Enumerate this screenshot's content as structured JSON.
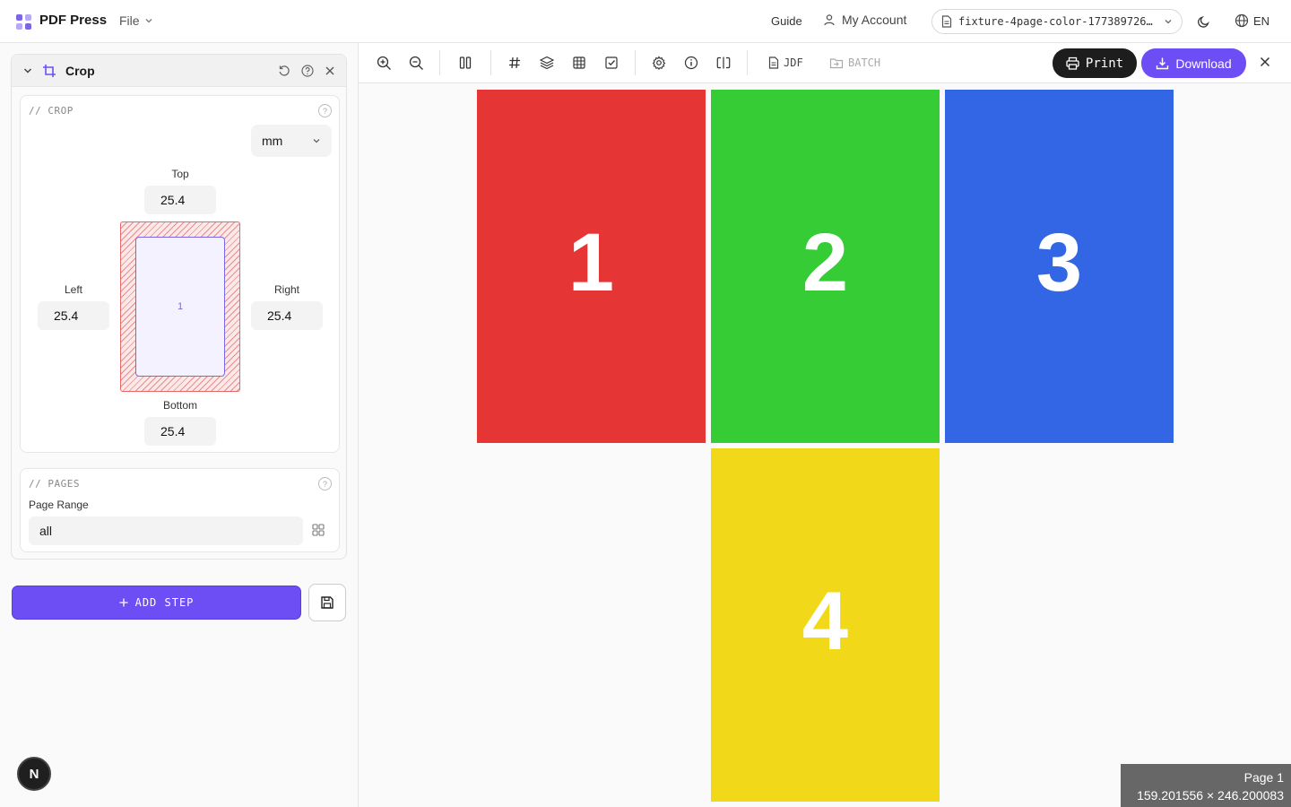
{
  "app": {
    "brand": "PDF Press",
    "file_menu": "File",
    "guide": "Guide",
    "account": "My Account",
    "file_name": "fixture-4page-color-177389726…",
    "language": "EN",
    "logo_colors": [
      "#7c66e8",
      "#a996f5",
      "#a996f5",
      "#7c66e8"
    ]
  },
  "step": {
    "title": "Crop",
    "crop_section_title": "// CROP",
    "help_glyph": "?",
    "unit": "mm",
    "top_label": "Top",
    "top_value": "25.4",
    "left_label": "Left",
    "left_value": "25.4",
    "right_label": "Right",
    "right_value": "25.4",
    "bottom_label": "Bottom",
    "bottom_value": "25.4",
    "preview_page": "1",
    "pages_section_title": "// PAGES",
    "page_range_label": "Page Range",
    "page_range_value": "all"
  },
  "actions": {
    "add_step": "ADD STEP",
    "n_badge": "N"
  },
  "toolbar": {
    "jdf": "JDF",
    "batch": "BATCH",
    "print": "Print",
    "download": "Download"
  },
  "canvas": {
    "pages": [
      {
        "label": "1",
        "color": "#e53535"
      },
      {
        "label": "2",
        "color": "#35cc35"
      },
      {
        "label": "3",
        "color": "#3366e4"
      },
      {
        "label": "4",
        "color": "#f1d91a"
      }
    ],
    "page_info_title": "Page 1",
    "page_info_size": "159.201556 × 246.200083"
  },
  "colors": {
    "accent": "#6d4ef5",
    "dark": "#1d1d1d"
  }
}
